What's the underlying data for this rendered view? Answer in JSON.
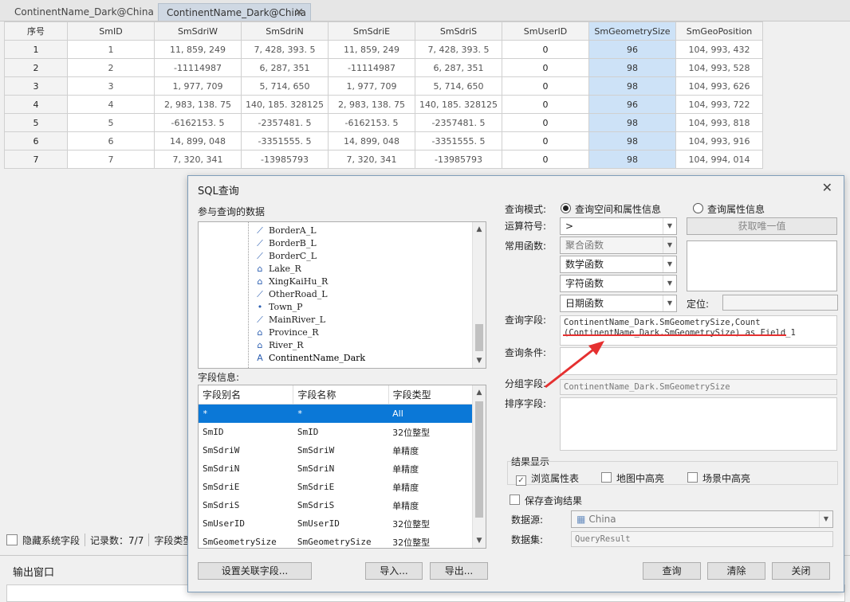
{
  "tabs": [
    {
      "label": "ContinentName_Dark@China"
    },
    {
      "label": "ContinentName_Dark@China"
    }
  ],
  "grid": {
    "headers": [
      "序号",
      "SmID",
      "SmSdriW",
      "SmSdriN",
      "SmSdriE",
      "SmSdriS",
      "SmUserID",
      "SmGeometrySize",
      "SmGeoPosition"
    ],
    "rows": [
      [
        "1",
        "1",
        "11, 859, 249",
        "7, 428, 393. 5",
        "11, 859, 249",
        "7, 428, 393. 5",
        "0",
        "96",
        "104, 993, 432"
      ],
      [
        "2",
        "2",
        "-11114987",
        "6, 287, 351",
        "-11114987",
        "6, 287, 351",
        "0",
        "98",
        "104, 993, 528"
      ],
      [
        "3",
        "3",
        "1, 977, 709",
        "5, 714, 650",
        "1, 977, 709",
        "5, 714, 650",
        "0",
        "98",
        "104, 993, 626"
      ],
      [
        "4",
        "4",
        "2, 983, 138. 75",
        "140, 185. 328125",
        "2, 983, 138. 75",
        "140, 185. 328125",
        "0",
        "96",
        "104, 993, 722"
      ],
      [
        "5",
        "5",
        "-6162153. 5",
        "-2357481. 5",
        "-6162153. 5",
        "-2357481. 5",
        "0",
        "98",
        "104, 993, 818"
      ],
      [
        "6",
        "6",
        "14, 899, 048",
        "-3351555. 5",
        "14, 899, 048",
        "-3351555. 5",
        "0",
        "98",
        "104, 993, 916"
      ],
      [
        "7",
        "7",
        "7, 320, 341",
        "-13985793",
        "7, 320, 341",
        "-13985793",
        "0",
        "98",
        "104, 994, 014"
      ]
    ]
  },
  "status": {
    "hide_system_fields": "隐藏系统字段",
    "record_count": "记录数：7/7",
    "field_type": "字段类型"
  },
  "output": {
    "title": "输出窗口"
  },
  "dialog": {
    "title": "SQL查询",
    "data_label": "参与查询的数据",
    "layers": [
      {
        "name": "BorderA_L",
        "icon": "line-layer-icon",
        "glyph": "⟋"
      },
      {
        "name": "BorderB_L",
        "icon": "line-layer-icon",
        "glyph": "⟋"
      },
      {
        "name": "BorderC_L",
        "icon": "line-layer-icon",
        "glyph": "⟋"
      },
      {
        "name": "Lake_R",
        "icon": "region-layer-icon",
        "glyph": "⌂"
      },
      {
        "name": "XingKaiHu_R",
        "icon": "region-layer-icon",
        "glyph": "⌂"
      },
      {
        "name": "OtherRoad_L",
        "icon": "line-layer-icon",
        "glyph": "⟋"
      },
      {
        "name": "Town_P",
        "icon": "point-layer-icon",
        "glyph": "•"
      },
      {
        "name": "MainRiver_L",
        "icon": "line-layer-icon",
        "glyph": "⟋"
      },
      {
        "name": "Province_R",
        "icon": "region-layer-icon",
        "glyph": "⌂"
      },
      {
        "name": "River_R",
        "icon": "region-layer-icon",
        "glyph": "⌂"
      },
      {
        "name": "ContinentName_Dark",
        "icon": "text-layer-icon",
        "glyph": "A"
      }
    ],
    "field_info_label": "字段信息:",
    "field_headers": [
      "字段别名",
      "字段名称",
      "字段类型"
    ],
    "fields": [
      [
        "*",
        "*",
        "All"
      ],
      [
        "SmID",
        "SmID",
        "32位整型"
      ],
      [
        "SmSdriW",
        "SmSdriW",
        "单精度"
      ],
      [
        "SmSdriN",
        "SmSdriN",
        "单精度"
      ],
      [
        "SmSdriE",
        "SmSdriE",
        "单精度"
      ],
      [
        "SmSdriS",
        "SmSdriS",
        "单精度"
      ],
      [
        "SmUserID",
        "SmUserID",
        "32位整型"
      ],
      [
        "SmGeometrySize",
        "SmGeometrySize",
        "32位整型"
      ]
    ],
    "query_mode_label": "查询模式:",
    "mode_spatial_attr": "查询空间和属性信息",
    "mode_attr": "查询属性信息",
    "operator_label": "运算符号:",
    "operator_value": ">",
    "get_unique_button": "获取唯一值",
    "functions_label": "常用函数:",
    "functions": [
      "聚合函数",
      "数学函数",
      "字符函数",
      "日期函数"
    ],
    "locate_label": "定位:",
    "query_field_label": "查询字段:",
    "query_field_value": "ContinentName_Dark.SmGeometrySize,Count (ContinentName_Dark.SmGeometrySize) as Field_1",
    "query_condition_label": "查询条件:",
    "group_field_label": "分组字段:",
    "group_field_value": "ContinentName_Dark.SmGeometrySize",
    "sort_field_label": "排序字段:",
    "result_display_label": "结果显示",
    "browse_attr": "浏览属性表",
    "map_highlight": "地图中高亮",
    "scene_highlight": "场景中高亮",
    "save_result": "保存查询结果",
    "datasource_label": "数据源:",
    "datasource_value": "China",
    "dataset_label": "数据集:",
    "dataset_value": "QueryResult",
    "buttons": {
      "set_join": "设置关联字段...",
      "import": "导入...",
      "export": "导出...",
      "query": "查询",
      "clear": "清除",
      "close": "关闭"
    }
  },
  "colors": {
    "selection": "#cde2f7",
    "row_selected": "#0b78d7",
    "annotation": "#e53030"
  }
}
